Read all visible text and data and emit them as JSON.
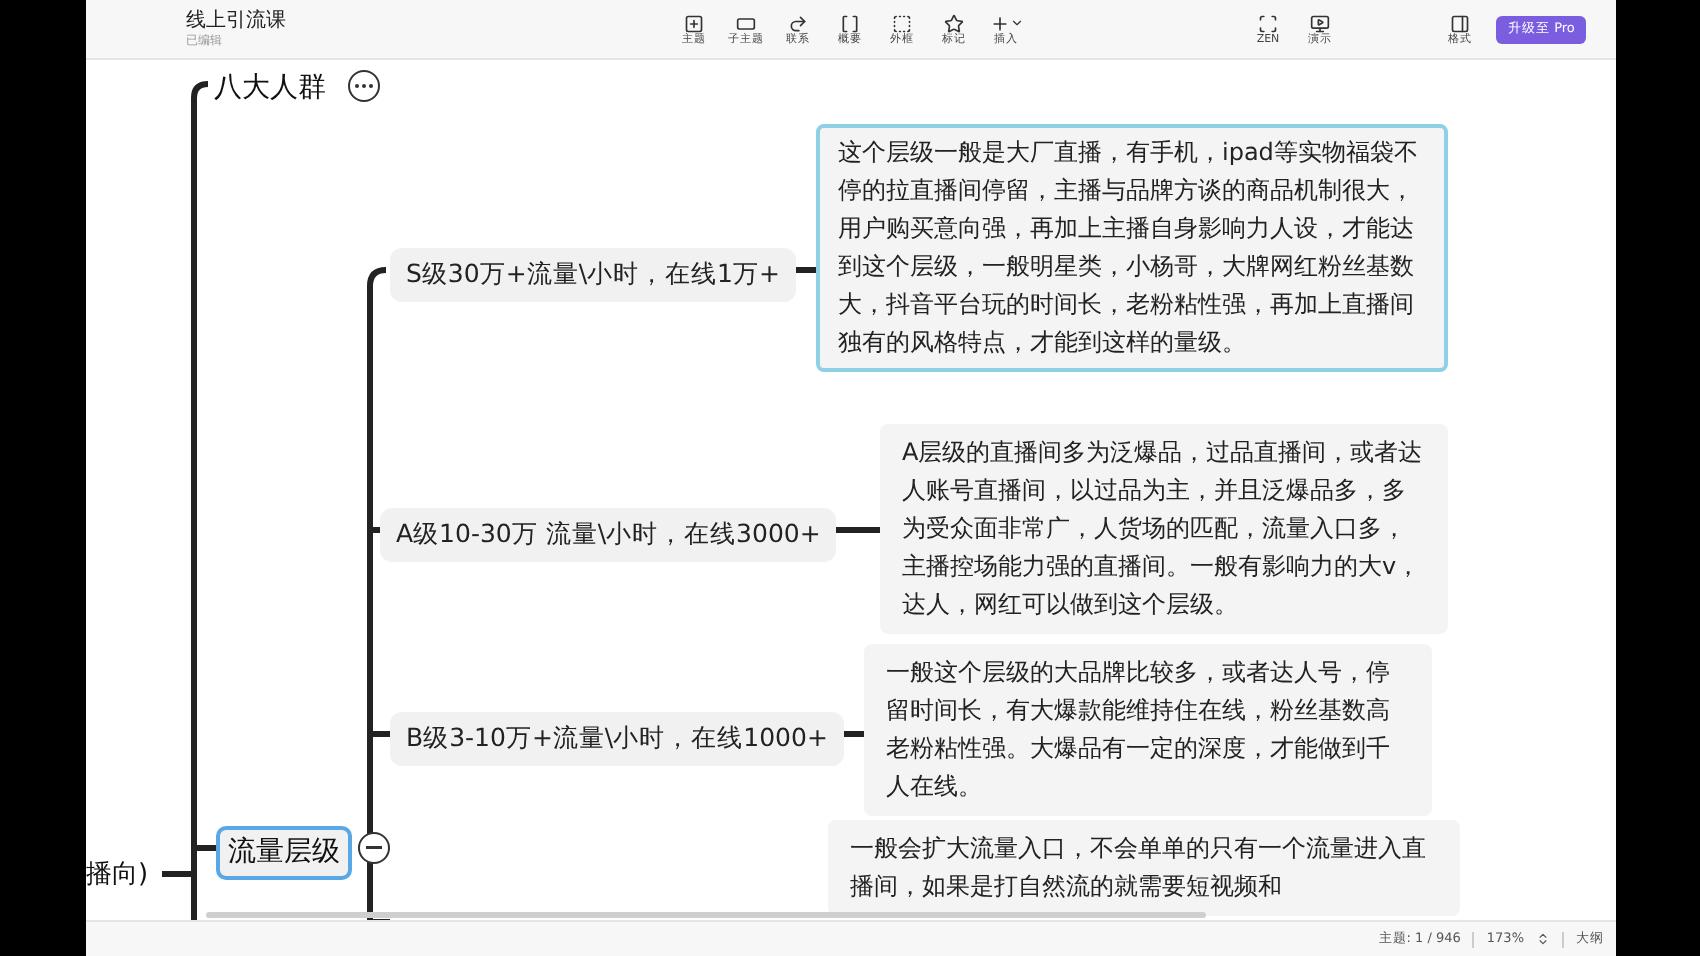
{
  "document": {
    "title": "线上引流课",
    "status": "已编辑"
  },
  "toolbar": [
    {
      "label": "主题"
    },
    {
      "label": "子主题"
    },
    {
      "label": "联系"
    },
    {
      "label": "概要"
    },
    {
      "label": "外框"
    },
    {
      "label": "标记"
    },
    {
      "label": "插入"
    }
  ],
  "view_tools": [
    {
      "label": "ZEN"
    },
    {
      "label": "演示"
    }
  ],
  "format": {
    "label": "格式"
  },
  "upgrade_button": {
    "label": "升级至 Pro"
  },
  "mindmap": {
    "root_partial": "播向)",
    "branches": [
      {
        "label": "八大人群",
        "selected": false,
        "collapsed": true
      },
      {
        "label": "流量层级",
        "selected": true,
        "collapsed": false,
        "children": [
          {
            "label": "S级30万+流量\\小时，在线1万+",
            "selected": false,
            "note": "这个层级一般是大厂直播，有手机，ipad等实物福袋不停的拉直播间停留，主播与品牌方谈的商品机制很大，用户购买意向强，再加上主播自身影响力人设，才能达到这个层级，一般明星类，小杨哥，大牌网红粉丝基数大，抖音平台玩的时间长，老粉粘性强，再加上直播间独有的风格特点，才能到这样的量级。",
            "note_selected": true
          },
          {
            "label": "A级10-30万 流量\\小时，在线3000+",
            "selected": false,
            "note": "A层级的直播间多为泛爆品，过品直播间，或者达人账号直播间，以过品为主，并且泛爆品多，多为受众面非常广，人货场的匹配，流量入口多，主播控场能力强的直播间。一般有影响力的大v，达人，网红可以做到这个层级。",
            "note_selected": false
          },
          {
            "label": "B级3-10万+流量\\小时，在线1000+",
            "selected": false,
            "note": "一般这个层级的大品牌比较多，或者达人号，停留时间长，有大爆款能维持住在线，粉丝基数高老粉粘性强。大爆品有一定的深度，才能做到千人在线。",
            "note_selected": false
          },
          {
            "note": "一般会扩大流量入口，不会单单的只有一个流量进入直播间，如果是打自然流的就需要短视频和",
            "note_selected": false
          }
        ]
      }
    ]
  },
  "status_bar": {
    "topic_count": "主题: 1 / 946",
    "zoom": "173%",
    "outline": "大纲"
  }
}
